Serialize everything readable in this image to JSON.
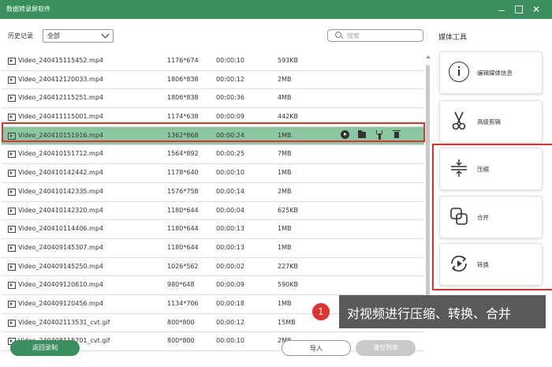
{
  "window": {
    "title": "数据转录屏软件"
  },
  "toolbar": {
    "history_label": "历史记录",
    "filter_value": "全部",
    "search_placeholder": "搜索"
  },
  "sidebar": {
    "title": "媒体工具",
    "tools": [
      {
        "label": "编辑媒体信息",
        "icon": "info-icon"
      },
      {
        "label": "高级剪辑",
        "icon": "scissors-icon"
      },
      {
        "label": "压缩",
        "icon": "compress-icon"
      },
      {
        "label": "合并",
        "icon": "merge-icon"
      },
      {
        "label": "转换",
        "icon": "convert-icon"
      }
    ]
  },
  "files": [
    {
      "name": "Video_240415115452.mp4",
      "res": "1176*674",
      "dur": "00:00:10",
      "size": "593KB"
    },
    {
      "name": "Video_240412120033.mp4",
      "res": "1806*838",
      "dur": "00:00:12",
      "size": "2MB"
    },
    {
      "name": "Video_240412115251.mp4",
      "res": "1806*838",
      "dur": "00:00:36",
      "size": "4MB"
    },
    {
      "name": "Video_240411115001.mp4",
      "res": "1174*638",
      "dur": "00:00:09",
      "size": "442KB"
    },
    {
      "name": "Video_240410151916.mp4",
      "res": "1362*868",
      "dur": "00:00:24",
      "size": "1MB",
      "selected": true
    },
    {
      "name": "Video_240410151712.mp4",
      "res": "1564*892",
      "dur": "00:00:25",
      "size": "7MB"
    },
    {
      "name": "Video_240410142442.mp4",
      "res": "1178*640",
      "dur": "00:00:10",
      "size": "1MB"
    },
    {
      "name": "Video_240410142335.mp4",
      "res": "1576*758",
      "dur": "00:00:14",
      "size": "2MB"
    },
    {
      "name": "Video_240410142320.mp4",
      "res": "1180*644",
      "dur": "00:00:04",
      "size": "625KB"
    },
    {
      "name": "Video_240410114406.mp4",
      "res": "1180*644",
      "dur": "00:00:13",
      "size": "1MB"
    },
    {
      "name": "Video_240409145307.mp4",
      "res": "1180*644",
      "dur": "00:00:13",
      "size": "1MB"
    },
    {
      "name": "Video_240409145250.mp4",
      "res": "1026*562",
      "dur": "00:00:02",
      "size": "227KB"
    },
    {
      "name": "Video_240409120610.mp4",
      "res": "980*648",
      "dur": "00:00:09",
      "size": "590KB"
    },
    {
      "name": "Video_240409120456.mp4",
      "res": "1134*706",
      "dur": "00:00:18",
      "size": "1MB"
    },
    {
      "name": "Video_240402113531_cvt.gif",
      "res": "800*800",
      "dur": "00:00:12",
      "size": "15MB"
    },
    {
      "name": "Video_240408115701_cvt.gif",
      "res": "800*800",
      "dur": "00:00:10",
      "size": "2MB"
    }
  ],
  "annotation": {
    "badge": "1",
    "text": "对视频进行压缩、转换、合并"
  },
  "buttons": {
    "back": "返回录制",
    "import": "导入",
    "clear": "清空列表"
  },
  "colors": {
    "brand": "#3a8f5e",
    "selected_row": "#8cc89f",
    "highlight": "#e03030"
  }
}
